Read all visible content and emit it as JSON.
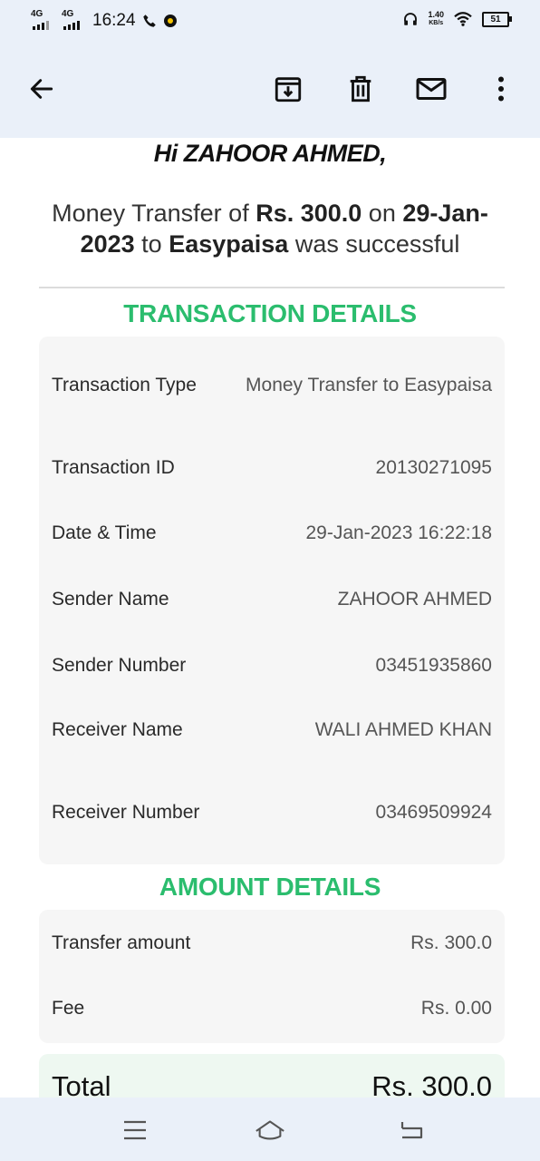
{
  "status_bar": {
    "network1": "4G",
    "network2": "4G",
    "time": "16:24",
    "speed_value": "1.40",
    "speed_unit": "KB/s",
    "battery": "51"
  },
  "toolbar": {
    "back_icon": "arrow-left-icon",
    "archive_icon": "archive-icon",
    "delete_icon": "trash-icon",
    "mail_icon": "mail-icon",
    "more_icon": "more-vertical-icon"
  },
  "email": {
    "greeting": "Hi ZAHOOR AHMED,",
    "summary": {
      "p1": "Money Transfer of ",
      "amount": "Rs. 300.0",
      "p2": " on ",
      "date": "29-Jan-2023",
      "p3": " to ",
      "recipient": "Easypaisa",
      "p4": " was successful"
    },
    "transaction_title": "TRANSACTION DETAILS",
    "transaction_rows": [
      {
        "label": "Transaction Type",
        "value": "Money Transfer to Easypaisa"
      },
      {
        "label": "Transaction ID",
        "value": "20130271095"
      },
      {
        "label": "Date & Time",
        "value": "29-Jan-2023 16:22:18"
      },
      {
        "label": "Sender Name",
        "value": "ZAHOOR AHMED"
      },
      {
        "label": "Sender Number",
        "value": "03451935860"
      },
      {
        "label": "Receiver Name",
        "value": "WALI AHMED KHAN"
      },
      {
        "label": "Receiver Number",
        "value": "03469509924"
      }
    ],
    "amount_title": "AMOUNT DETAILS",
    "amount_rows": [
      {
        "label": "Transfer amount",
        "value": "Rs. 300.0"
      },
      {
        "label": "Fee",
        "value": "Rs. 0.00"
      }
    ],
    "total": {
      "label": "Total",
      "value": "Rs. 300.0"
    }
  },
  "colors": {
    "accent_green": "#2bbd6e",
    "bar_background": "#eaf0f9",
    "card_background": "#f6f6f6"
  },
  "navbar": {
    "menu_icon": "menu-icon",
    "home_icon": "home-icon",
    "back_icon": "back-gesture-icon"
  }
}
